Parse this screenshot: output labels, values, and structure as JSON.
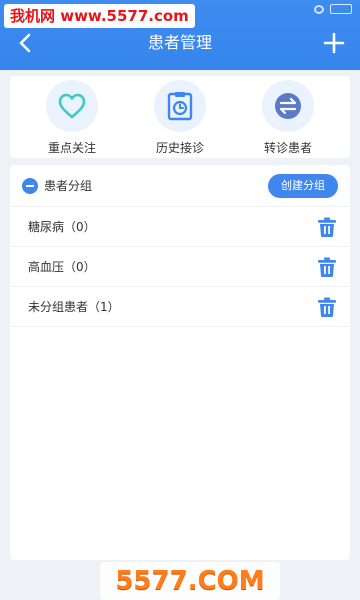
{
  "watermark": {
    "top_text": "我机网 www.5577.com",
    "bottom_text": "5577.COM"
  },
  "status_bar": {
    "icons": [
      "signal-icon",
      "battery-icon"
    ]
  },
  "nav": {
    "title": "患者管理",
    "back_icon": "chevron-left-icon",
    "add_icon": "plus-icon"
  },
  "quick_actions": [
    {
      "label": "重点关注",
      "icon": "heart-icon"
    },
    {
      "label": "历史接诊",
      "icon": "clipboard-clock-icon"
    },
    {
      "label": "转诊患者",
      "icon": "transfer-icon"
    }
  ],
  "groups": {
    "title": "患者分组",
    "create_label": "创建分组",
    "items": [
      {
        "label": "糖尿病（0）"
      },
      {
        "label": "高血压（0）"
      },
      {
        "label": "未分组患者（1）"
      }
    ]
  },
  "colors": {
    "primary": "#3f86ee",
    "icon_bg": "#e9f2fd",
    "heart": "#3fc9c0",
    "page_bg": "#eef2f6"
  }
}
